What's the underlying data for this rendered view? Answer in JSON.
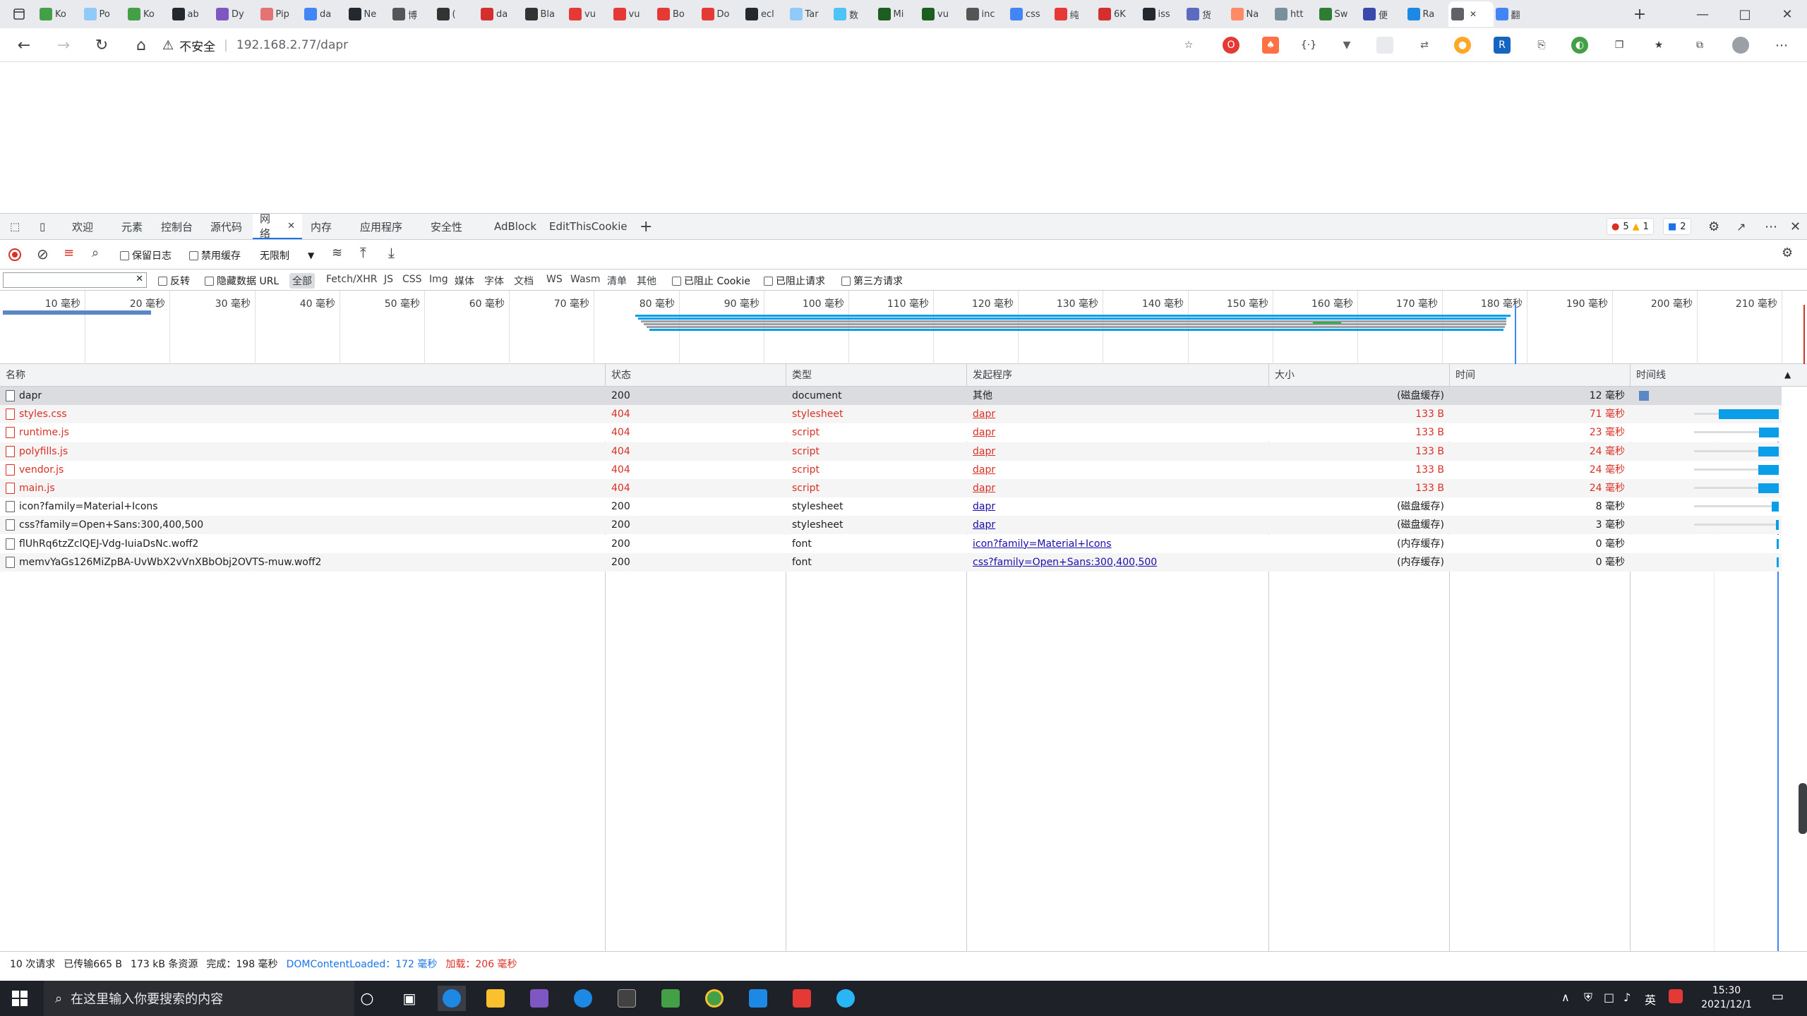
{
  "browser": {
    "tabs": [
      {
        "label": "Ko",
        "color": "#43a047"
      },
      {
        "label": "Po",
        "color": "#90caf9"
      },
      {
        "label": "Ko",
        "color": "#43a047"
      },
      {
        "label": "ab",
        "color": "#24292f"
      },
      {
        "label": "Dy",
        "color": "#7e57c2"
      },
      {
        "label": "Pip",
        "color": "#e57373"
      },
      {
        "label": "da",
        "color": "#4285f4"
      },
      {
        "label": "Ne",
        "color": "#24292f"
      },
      {
        "label": "博",
        "color": "#555555"
      },
      {
        "label": "(",
        "color": "#333333"
      },
      {
        "label": "da",
        "color": "#d32f2f"
      },
      {
        "label": "Bla",
        "color": "#333333"
      },
      {
        "label": "vu",
        "color": "#e53935"
      },
      {
        "label": "vu",
        "color": "#e53935"
      },
      {
        "label": "Bo",
        "color": "#e53935"
      },
      {
        "label": "Do",
        "color": "#e53935"
      },
      {
        "label": "ecl",
        "color": "#24292f"
      },
      {
        "label": "Tar",
        "color": "#90caf9"
      },
      {
        "label": "数",
        "color": "#4fc3f7"
      },
      {
        "label": "Mi",
        "color": "#1b5e20"
      },
      {
        "label": "vu",
        "color": "#1b5e20"
      },
      {
        "label": "inc",
        "color": "#555555"
      },
      {
        "label": "css",
        "color": "#4285f4"
      },
      {
        "label": "纯",
        "color": "#e53935"
      },
      {
        "label": "6K",
        "color": "#d32f2f"
      },
      {
        "label": "iss",
        "color": "#24292f"
      },
      {
        "label": "货",
        "color": "#5c6bc0"
      },
      {
        "label": "Na",
        "color": "#ff8a65"
      },
      {
        "label": "htt",
        "color": "#78909c"
      },
      {
        "label": "Sw",
        "color": "#2e7d32"
      },
      {
        "label": "便",
        "color": "#3949ab"
      },
      {
        "label": "Ra",
        "color": "#1e88e5"
      },
      {
        "label": "",
        "color": "#5f6368"
      },
      {
        "label": "翻",
        "color": "#4285f4"
      }
    ],
    "new_tab": "+",
    "window_controls": [
      "minimize-icon",
      "maximize-icon",
      "close-icon"
    ],
    "address": {
      "security_label": "不安全",
      "url": "192.168.2.77/dapr"
    },
    "nav": [
      "back-icon",
      "forward-icon",
      "reload-icon",
      "home-icon"
    ]
  },
  "devtools": {
    "tabs": [
      "欢迎",
      "元素",
      "控制台",
      "源代码",
      "网络",
      "内存",
      "应用程序",
      "安全性",
      "AdBlock",
      "EditThisCookie"
    ],
    "active_tab": "网络",
    "badges": {
      "errors": "5",
      "warnings": "1",
      "messages": "2"
    },
    "toolbar": {
      "preserve_log": "保留日志",
      "disable_cache": "禁用缓存",
      "throttling": "无限制"
    },
    "filter": {
      "placeholder": "",
      "invert": "反转",
      "hide_data_urls": "隐藏数据 URL",
      "types": [
        "全部",
        "Fetch/XHR",
        "JS",
        "CSS",
        "Img",
        "媒体",
        "字体",
        "文档",
        "WS",
        "Wasm",
        "清单",
        "其他"
      ],
      "active_type": "全部",
      "blocked_cookies": "已阻止 Cookie",
      "blocked_requests": "已阻止请求",
      "third_party": "第三方请求"
    },
    "overview_ticks": [
      "10 毫秒",
      "20 毫秒",
      "30 毫秒",
      "40 毫秒",
      "50 毫秒",
      "60 毫秒",
      "70 毫秒",
      "80 毫秒",
      "90 毫秒",
      "100 毫秒",
      "110 毫秒",
      "120 毫秒",
      "130 毫秒",
      "140 毫秒",
      "150 毫秒",
      "160 毫秒",
      "170 毫秒",
      "180 毫秒",
      "190 毫秒",
      "200 毫秒",
      "210 毫秒"
    ],
    "columns": [
      "名称",
      "状态",
      "类型",
      "发起程序",
      "大小",
      "时间",
      "时间线"
    ],
    "rows": [
      {
        "name": "dapr",
        "status": "200",
        "type": "document",
        "initiator": "其他",
        "initiator_link": false,
        "size": "(磁盘缓存)",
        "time": "12 毫秒",
        "error": false
      },
      {
        "name": "styles.css",
        "status": "404",
        "type": "stylesheet",
        "initiator": "dapr",
        "initiator_link": true,
        "size": "133 B",
        "time": "71 毫秒",
        "error": true
      },
      {
        "name": "runtime.js",
        "status": "404",
        "type": "script",
        "initiator": "dapr",
        "initiator_link": true,
        "size": "133 B",
        "time": "23 毫秒",
        "error": true
      },
      {
        "name": "polyfills.js",
        "status": "404",
        "type": "script",
        "initiator": "dapr",
        "initiator_link": true,
        "size": "133 B",
        "time": "24 毫秒",
        "error": true
      },
      {
        "name": "vendor.js",
        "status": "404",
        "type": "script",
        "initiator": "dapr",
        "initiator_link": true,
        "size": "133 B",
        "time": "24 毫秒",
        "error": true
      },
      {
        "name": "main.js",
        "status": "404",
        "type": "script",
        "initiator": "dapr",
        "initiator_link": true,
        "size": "133 B",
        "time": "24 毫秒",
        "error": true
      },
      {
        "name": "icon?family=Material+Icons",
        "status": "200",
        "type": "stylesheet",
        "initiator": "dapr",
        "initiator_link": true,
        "size": "(磁盘缓存)",
        "time": "8 毫秒",
        "error": false
      },
      {
        "name": "css?family=Open+Sans:300,400,500",
        "status": "200",
        "type": "stylesheet",
        "initiator": "dapr",
        "initiator_link": true,
        "size": "(磁盘缓存)",
        "time": "3 毫秒",
        "error": false
      },
      {
        "name": "flUhRq6tzZclQEJ-Vdg-IuiaDsNc.woff2",
        "status": "200",
        "type": "font",
        "initiator": "icon?family=Material+Icons",
        "initiator_link": true,
        "size": "(内存缓存)",
        "time": "0 毫秒",
        "error": false
      },
      {
        "name": "memvYaGs126MiZpBA-UvWbX2vVnXBbObj2OVTS-muw.woff2",
        "status": "200",
        "type": "font",
        "initiator": "css?family=Open+Sans:300,400,500",
        "initiator_link": true,
        "size": "(内存缓存)",
        "time": "0 毫秒",
        "error": false
      }
    ],
    "status_bar": {
      "requests": "10 次请求",
      "transferred": "已传输665 B",
      "resources": "173 kB 条资源",
      "finish": "完成：198 毫秒",
      "dcl": "DOMContentLoaded：172 毫秒",
      "load": "加载：206 毫秒"
    }
  },
  "taskbar": {
    "search_placeholder": "在这里输入你要搜索的内容",
    "ime": "英",
    "time": "15:30",
    "date": "2021/12/1"
  },
  "colors": {
    "accent": "#1a73e8",
    "error": "#d93025",
    "timeline_bar": "#0a9ee8"
  }
}
